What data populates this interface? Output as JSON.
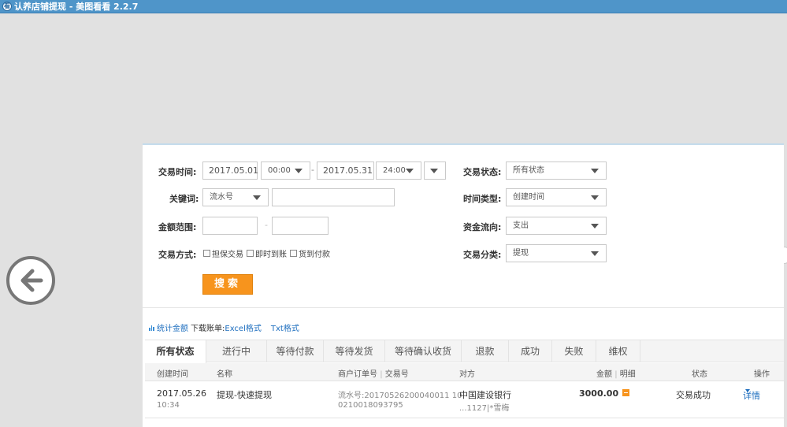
{
  "window": {
    "title": "认养店铺提现 - 美图看看 2.2.7",
    "icon_glyph": "看"
  },
  "filters": {
    "trade_time_label": "交易时间:",
    "start_date": "2017.05.01",
    "start_time": "00:00",
    "end_date": "2017.05.31",
    "end_time": "24:00",
    "range_sep": "-",
    "keyword_label": "关键词:",
    "keyword_type": "流水号",
    "keyword_value": "",
    "amount_label": "金额范围:",
    "amount_min": "",
    "amount_max": "",
    "amount_sep": "-",
    "method_label": "交易方式:",
    "methods": [
      "担保交易",
      "即时到账",
      "货到付款"
    ],
    "status_label": "交易状态:",
    "status_value": "所有状态",
    "time_type_label": "时间类型:",
    "time_type_value": "创建时间",
    "flow_label": "资金流向:",
    "flow_value": "支出",
    "category_label": "交易分类:",
    "category_value": "提现",
    "search_button": "搜索"
  },
  "stats": {
    "stat_amount_link": "统计金额",
    "download_label": "下载账单:",
    "excel_link": "Excel格式",
    "txt_link": "Txt格式"
  },
  "tabs": [
    "所有状态",
    "进行中",
    "等待付款",
    "等待发货",
    "等待确认收货",
    "退款",
    "成功",
    "失败",
    "维权"
  ],
  "table": {
    "columns": {
      "created": "创建时间",
      "name": "名称",
      "order_no": "商户订单号",
      "sep": "|",
      "trade_no": "交易号",
      "counterparty": "对方",
      "amount": "金额",
      "detail": "明细",
      "status": "状态",
      "action": "操作"
    },
    "rows": [
      {
        "date": "2017.05.26",
        "time": "10:34",
        "name": "提现-快速提现",
        "serial_line1": "流水号:20170526200040011 10",
        "serial_line2": "0210018093795",
        "bank": "中国建设银行",
        "account": "...1127|*雪梅",
        "amount": "3000.00",
        "status": "交易成功",
        "action": "详情"
      }
    ]
  }
}
